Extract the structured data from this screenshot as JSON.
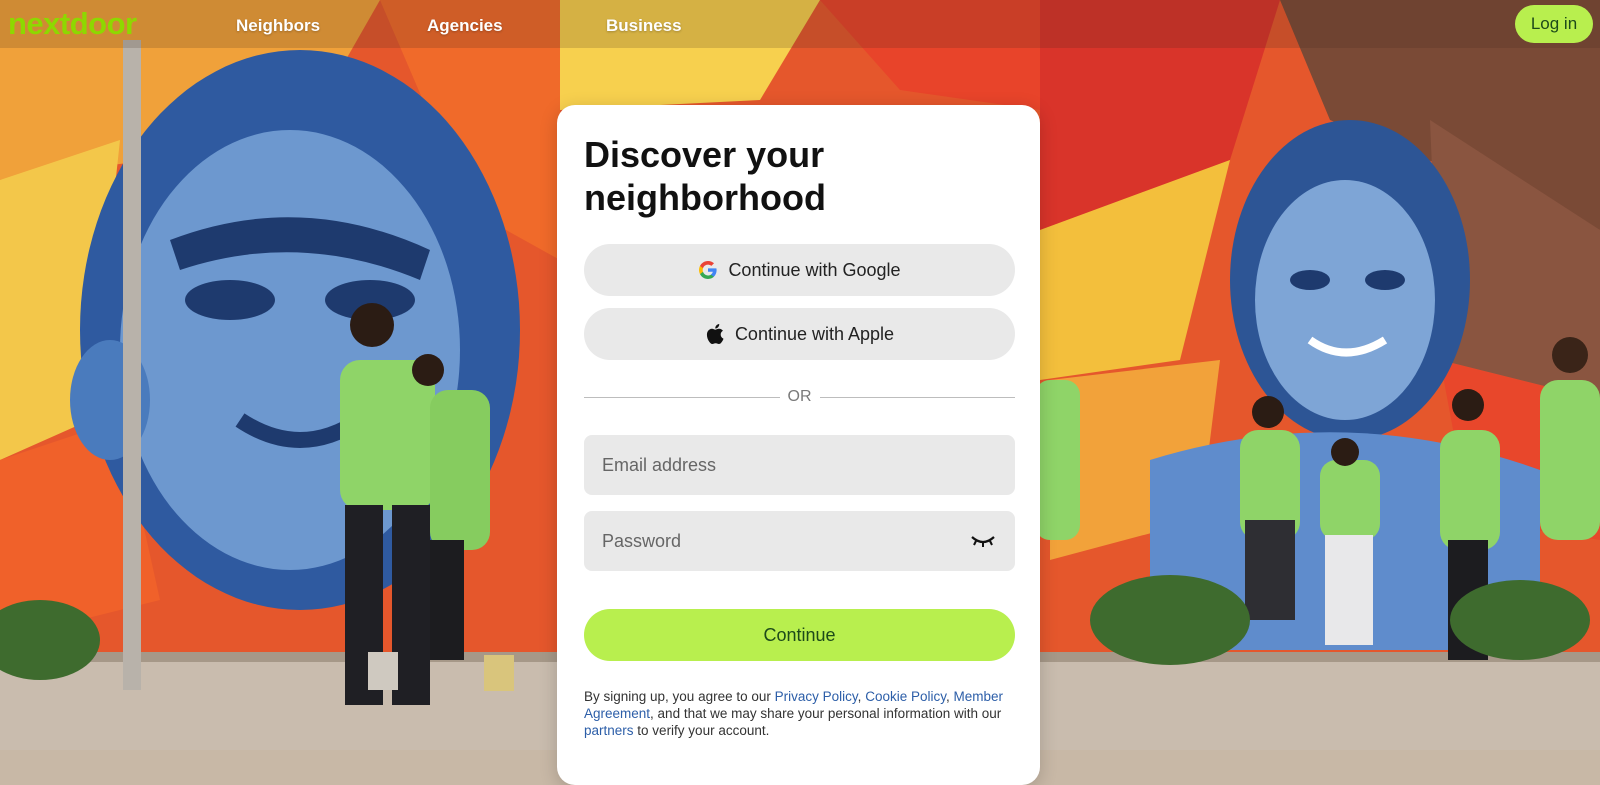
{
  "brand": {
    "logo_text": "nextdoor",
    "accent": "#8ed800",
    "button_green": "#b8ef4e"
  },
  "nav": {
    "links": [
      {
        "label": "Neighbors"
      },
      {
        "label": "Agencies"
      },
      {
        "label": "Business"
      }
    ],
    "login_label": "Log in"
  },
  "card": {
    "title": "Discover your neighborhood",
    "google_label": "Continue with Google",
    "google_icon": "google-g-icon",
    "apple_label": "Continue with Apple",
    "apple_icon": "apple-logo-icon",
    "divider_text": "OR",
    "email_placeholder": "Email address",
    "password_placeholder": "Password",
    "password_toggle_icon": "eye-closed-icon",
    "continue_label": "Continue",
    "legal": {
      "prefix": "By signing up, you agree to our",
      "privacy": "Privacy Policy",
      "comma1": ",",
      "cookie": "Cookie Policy",
      "comma2": ",",
      "member": "Member Agreement",
      "middle": ", and that we may share your personal information with our",
      "partners": "partners",
      "suffix": "to verify your account."
    }
  },
  "background": {
    "description_icon": "mural-photo"
  }
}
